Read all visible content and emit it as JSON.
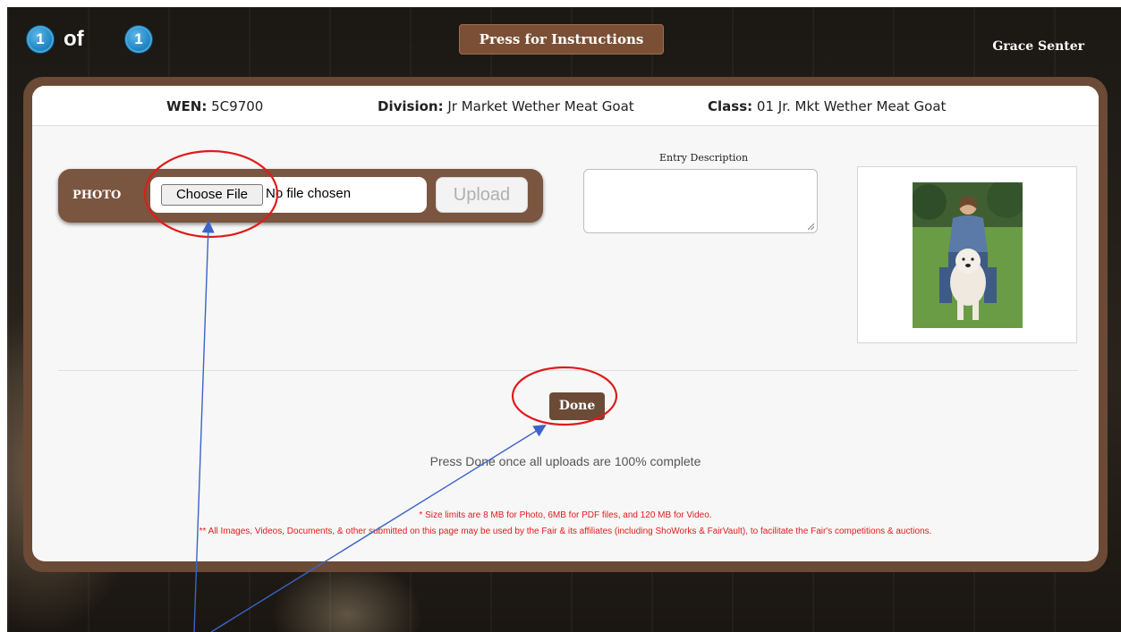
{
  "top_bar": {
    "current": "1",
    "of_label": "of",
    "total": "1",
    "instructions_label": "Press for Instructions",
    "user_name": "Grace Senter"
  },
  "entry": {
    "wen_label": "WEN:",
    "wen_value": "5C9700",
    "division_label": "Division:",
    "division_value": "Jr Market Wether Meat Goat",
    "class_label": "Class:",
    "class_value": "01 Jr. Mkt Wether Meat Goat"
  },
  "photo": {
    "label": "PHOTO",
    "choose_label": "Choose File",
    "file_status": "No file chosen",
    "upload_label": "Upload"
  },
  "description": {
    "label": "Entry Description",
    "value": ""
  },
  "actions": {
    "done_label": "Done",
    "done_note": "Press Done once all uploads are 100% complete"
  },
  "notes": {
    "size_limits": "* Size limits are 8 MB for Photo, 6MB for PDF files, and 120 MB for Video.",
    "usage": "** All Images, Videos, Documents, & other submitted on this page may be used by the Fair & its affiliates (including ShoWorks & FairVault), to facilitate the Fair's competitions & auctions."
  },
  "colors": {
    "brand_brown": "#6b4a36",
    "badge_blue": "#1f86c4",
    "annotation_red": "#e01b1b",
    "arrow_blue": "#3a64c8"
  }
}
